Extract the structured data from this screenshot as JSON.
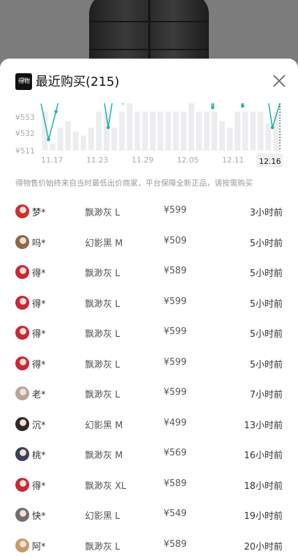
{
  "header": {
    "logo_text": "得物",
    "title": "最近购买(215)"
  },
  "chart_data": {
    "type": "line",
    "y_tick_labels": [
      "¥553",
      "¥532",
      "¥511"
    ],
    "x_tick_labels": [
      "11.17",
      "11.23",
      "11.29",
      "12.05",
      "12.11",
      "12.16"
    ],
    "highlighted_x_label": "12.16",
    "accent_color": "#26b2a9",
    "bar_color": "#ededf0",
    "bars": [
      560,
      520,
      540,
      548,
      535,
      530,
      540,
      560,
      560,
      540,
      560,
      580,
      560,
      560,
      560,
      560,
      560,
      560,
      560,
      580,
      560,
      560,
      560,
      548,
      540,
      560,
      560,
      560,
      560,
      545,
      560
    ],
    "line": [
      570,
      525,
      560,
      600,
      600,
      600,
      600,
      600,
      600,
      540,
      600,
      570,
      600,
      600,
      600,
      600,
      600,
      600,
      600,
      600,
      600,
      600,
      600,
      565,
      600,
      600,
      600,
      567,
      600,
      600,
      600,
      540,
      570
    ]
  },
  "note": "得物售价始终来自当时最低出价商家，平台保障全新正品，请按需购买",
  "purchases": [
    {
      "name": "梦*",
      "spec": "飘渺灰 L",
      "price": "¥599",
      "time": "3小时前",
      "avatar_color": "#c9332f"
    },
    {
      "name": "吗*",
      "spec": "幻影黑 M",
      "price": "¥509",
      "time": "5小时前",
      "avatar_color": "#8a6a4a"
    },
    {
      "name": "得*",
      "spec": "飘渺灰 L",
      "price": "¥589",
      "time": "5小时前",
      "avatar_color": "#c72a35"
    },
    {
      "name": "得*",
      "spec": "飘渺灰 L",
      "price": "¥599",
      "time": "5小时前",
      "avatar_color": "#c72a35"
    },
    {
      "name": "得*",
      "spec": "飘渺灰 L",
      "price": "¥599",
      "time": "5小时前",
      "avatar_color": "#c72a35"
    },
    {
      "name": "得*",
      "spec": "飘渺灰 L",
      "price": "¥599",
      "time": "5小时前",
      "avatar_color": "#c72a35"
    },
    {
      "name": "老*",
      "spec": "飘渺灰 L",
      "price": "¥599",
      "time": "7小时前",
      "avatar_color": "#b7a49a"
    },
    {
      "name": "沉*",
      "spec": "幻影黑 M",
      "price": "¥499",
      "time": "13小时前",
      "avatar_color": "#2b2b2b"
    },
    {
      "name": "桃*",
      "spec": "飘渺灰 M",
      "price": "¥569",
      "time": "16小时前",
      "avatar_color": "#3b3f5a"
    },
    {
      "name": "得*",
      "spec": "飘渺灰 XL",
      "price": "¥589",
      "time": "18小时前",
      "avatar_color": "#c72a35"
    },
    {
      "name": "快*",
      "spec": "幻影黑 L",
      "price": "¥549",
      "time": "19小时前",
      "avatar_color": "#6f6f6f"
    },
    {
      "name": "阿*",
      "spec": "飘渺灰 L",
      "price": "¥589",
      "time": "20小时前",
      "avatar_color": "#c89a6a"
    }
  ]
}
